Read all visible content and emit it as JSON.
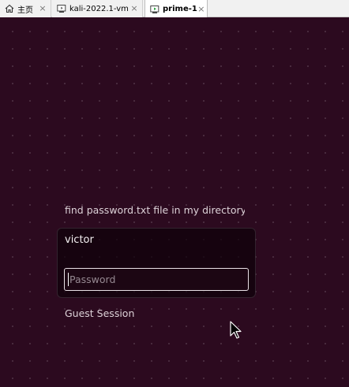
{
  "tabs": [
    {
      "label": "主页",
      "icon": "home-icon",
      "active": false
    },
    {
      "label": "kali-2022.1-vm",
      "icon": "vm-icon",
      "active": false
    },
    {
      "label": "prime-1",
      "icon": "vm-running-icon",
      "active": true
    }
  ],
  "greeter": {
    "message": "find password.txt file in my directory",
    "username": "victor",
    "password_placeholder": "Password",
    "guest_session_label": "Guest Session"
  },
  "colors": {
    "desktop_background": "#2c0a1f",
    "tabbar_background": "#f1f1f1"
  }
}
